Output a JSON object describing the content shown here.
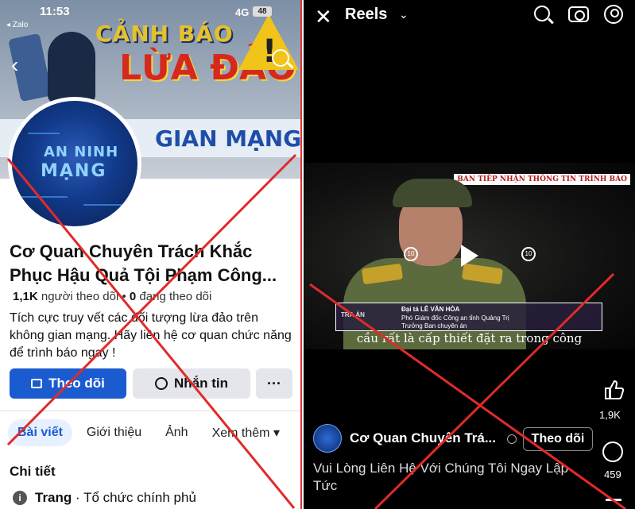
{
  "left": {
    "status": {
      "carrier": "◂ Zalo",
      "time": "11:53",
      "network": "4G",
      "battery": "48"
    },
    "cover": {
      "line1": "CẢNH BÁO",
      "line2": "LỪA ĐẢO",
      "strip": "GIAN MẠNG"
    },
    "avatar": {
      "line1": "AN NINH",
      "line2": "MẠNG"
    },
    "page_name": "Cơ Quan Chuyên Trách Khắc Phục Hậu Quả Tội Phạm Công...",
    "stats": {
      "followers_count": "1,1K",
      "followers_label": "người theo dõi",
      "following_count": "0",
      "following_label": "đang theo dõi"
    },
    "description": "Tích cực truy vết các đối tượng lừa đảo trên không gian mạng. Hãy liên hệ cơ quan chức năng để trình báo ngay !",
    "buttons": {
      "follow": "Theo dõi",
      "message": "Nhắn tin",
      "more": "···"
    },
    "tabs": [
      "Bài viết",
      "Giới thiệu",
      "Ảnh",
      "Xem thêm ▾"
    ],
    "details_title": "Chi tiết",
    "detail_row": {
      "type": "Trang",
      "category": "· Tổ chức chính phủ"
    }
  },
  "right": {
    "header": {
      "close": "✕",
      "title": "Reels",
      "chevron": "⌄"
    },
    "video": {
      "top_label": "BAN TIẾP NHẬN THÔNG TIN TRÌNH BÁO",
      "lower_third": {
        "tag": "TRA ÁN",
        "name": "Đại tá LÊ VĂN HÒA",
        "title1": "Phó Giám đốc Công an tỉnh Quảng Trị",
        "title2": "Trưởng Ban chuyên án"
      },
      "caption": "cầu rất là cấp thiết đặt ra trong công",
      "rewind": "10",
      "forward": "10"
    },
    "likes": "1,9K",
    "comments": "459",
    "author": "Cơ Quan Chuyên Trá...",
    "follow_label": "Theo dõi",
    "caption": "Vui Lòng Liên Hệ Với Chúng Tôi Ngay Lập Tức"
  },
  "colors": {
    "primary_blue": "#1b5bd0",
    "x_red": "#e12a2a",
    "reels_bg": "#000000"
  }
}
